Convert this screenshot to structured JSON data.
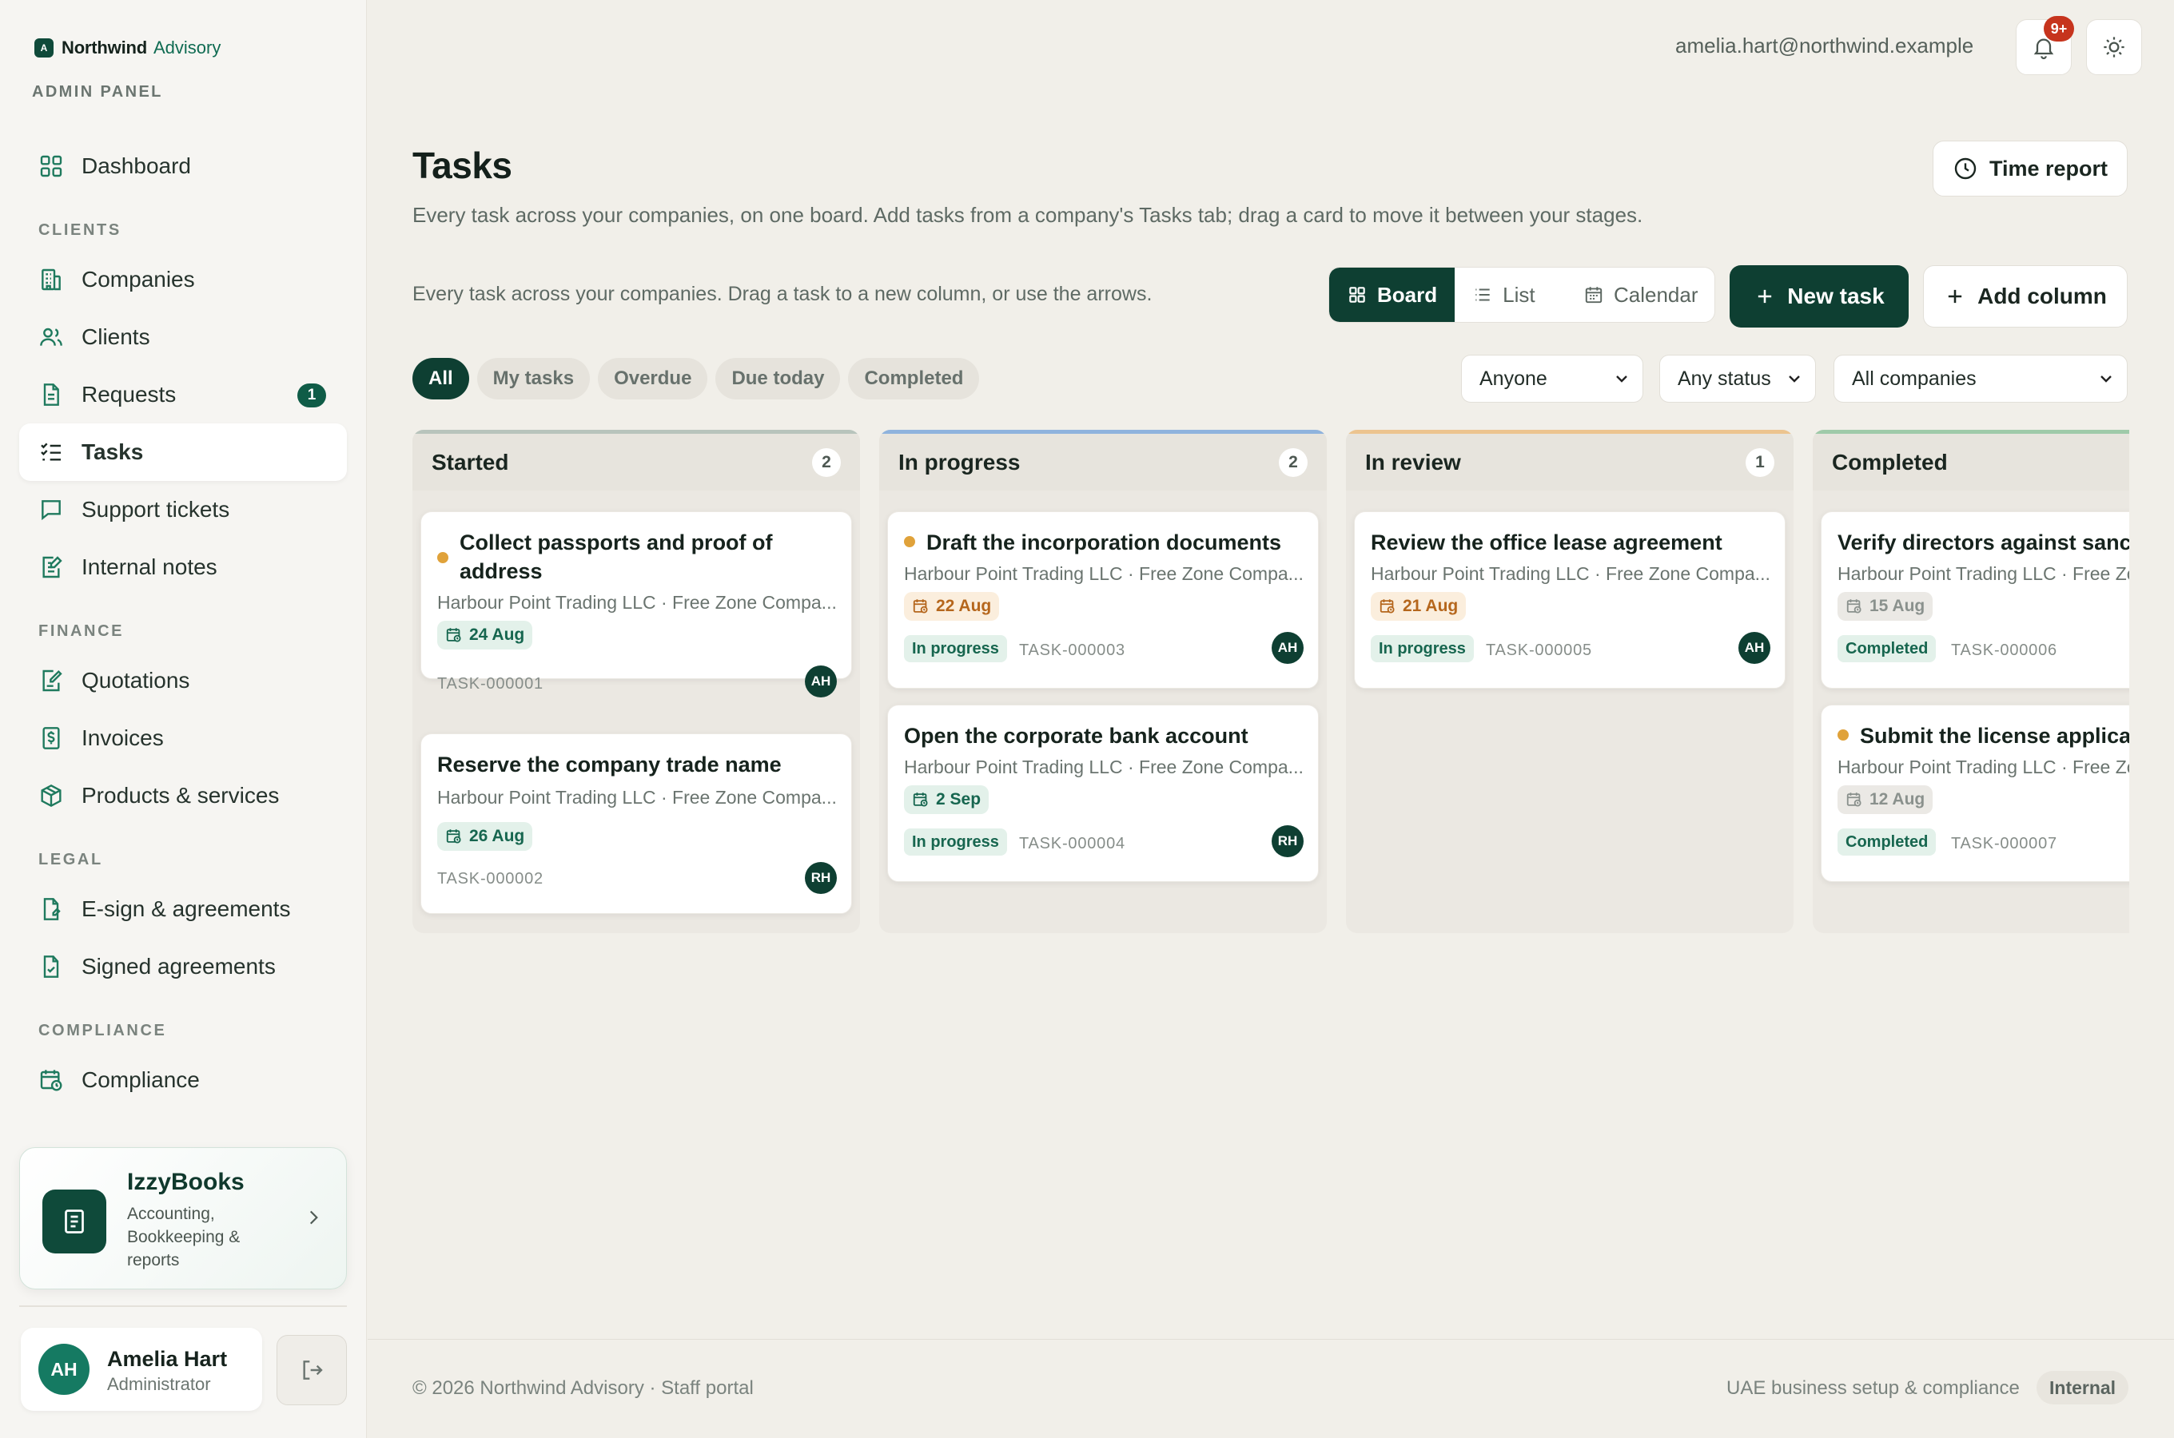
{
  "brand": {
    "name": "Northwind",
    "sub": "Advisory",
    "mark": "A",
    "panel_label": "ADMIN PANEL"
  },
  "sidebar": {
    "dashboard": "Dashboard",
    "section_clients": "CLIENTS",
    "companies": "Companies",
    "clients": "Clients",
    "requests": "Requests",
    "requests_badge": "1",
    "tasks": "Tasks",
    "support_tickets": "Support tickets",
    "internal_notes": "Internal notes",
    "section_finance": "FINANCE",
    "quotations": "Quotations",
    "invoices": "Invoices",
    "products": "Products & services",
    "section_legal": "LEGAL",
    "esign": "E-sign & agreements",
    "signed": "Signed agreements",
    "section_compliance": "COMPLIANCE",
    "compliance": "Compliance"
  },
  "promo": {
    "title": "IzzyBooks",
    "desc": "Accounting, Bookkeeping & reports"
  },
  "user": {
    "initials": "AH",
    "name": "Amelia Hart",
    "role": "Administrator"
  },
  "topbar": {
    "email": "amelia.hart@northwind.example",
    "notif_count": "9+"
  },
  "header": {
    "title": "Tasks",
    "description": "Every task across your companies, on one board. Add tasks from a company's Tasks tab; drag a card to move it between your stages.",
    "time_report": "Time report",
    "sub_description": "Every task across your companies. Drag a task to a new column, or use the arrows."
  },
  "views": {
    "board": "Board",
    "list": "List",
    "calendar": "Calendar"
  },
  "actions": {
    "new_task": "New task",
    "add_column": "Add column"
  },
  "filters": {
    "chips": [
      "All",
      "My tasks",
      "Overdue",
      "Due today",
      "Completed"
    ],
    "assignee": "Anyone",
    "status": "Any status",
    "company": "All companies"
  },
  "columns": [
    {
      "title": "Started",
      "count": "2",
      "accent": "#b8c4bc"
    },
    {
      "title": "In progress",
      "count": "2",
      "accent": "#8fb3dd"
    },
    {
      "title": "In review",
      "count": "1",
      "accent": "#ecc48f"
    },
    {
      "title": "Completed",
      "count": "",
      "accent": "#9fcaa9"
    }
  ],
  "cards": {
    "c1": {
      "title": "Collect passports and proof of address",
      "company": "Harbour Point Trading LLC · Free Zone Compa...",
      "date": "24 Aug",
      "id": "TASK-000001",
      "assignee": "AH"
    },
    "c2": {
      "title": "Reserve the company trade name",
      "company": "Harbour Point Trading LLC · Free Zone Compa...",
      "date": "26 Aug",
      "id": "TASK-000002",
      "assignee": "RH"
    },
    "c3": {
      "title": "Draft the incorporation documents",
      "company": "Harbour Point Trading LLC · Free Zone Compa...",
      "date": "22 Aug",
      "status": "In progress",
      "id": "TASK-000003",
      "assignee": "AH"
    },
    "c4": {
      "title": "Open the corporate bank account",
      "company": "Harbour Point Trading LLC · Free Zone Compa...",
      "date": "2 Sep",
      "status": "In progress",
      "id": "TASK-000004",
      "assignee": "RH"
    },
    "c5": {
      "title": "Review the office lease agreement",
      "company": "Harbour Point Trading LLC · Free Zone Compa...",
      "date": "21 Aug",
      "status": "In progress",
      "id": "TASK-000005",
      "assignee": "AH"
    },
    "c6": {
      "title": "Verify directors against sanctions lists",
      "company": "Harbour Point Trading LLC · Free Zone Company",
      "date": "15 Aug",
      "status": "Completed",
      "id": "TASK-000006"
    },
    "c7": {
      "title": "Submit the license application",
      "company": "Harbour Point Trading LLC · Free Zone Company",
      "date": "12 Aug",
      "status": "Completed",
      "id": "TASK-000007"
    }
  },
  "footer": {
    "left": "© 2026 Northwind Advisory · Staff portal",
    "right": "UAE business setup & compliance",
    "badge": "Internal"
  },
  "colors": {
    "primary": "#0e3f32",
    "accent_green": "#1f7a5e",
    "warning": "#e0a23a",
    "danger": "#c6341d"
  }
}
